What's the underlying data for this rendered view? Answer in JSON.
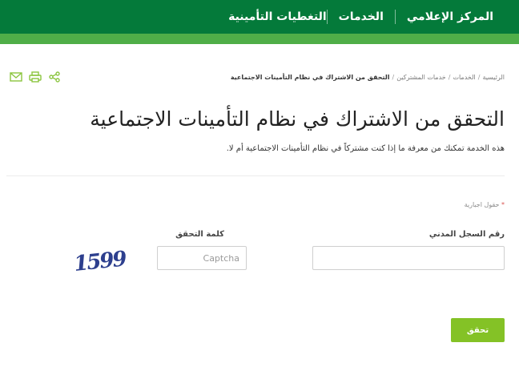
{
  "nav": {
    "items": [
      {
        "label": "التغطيات التأمينية"
      },
      {
        "label": "الخدمات"
      },
      {
        "label": "المركز الإعلامي"
      }
    ]
  },
  "breadcrumb": {
    "items": [
      "الرئيسية",
      "الخدمات",
      "خدمات المشتركين"
    ],
    "separator": "/",
    "current": "التحقق من الاشتراك في نظام التأمينات الاجتماعية"
  },
  "tools": {
    "icons": [
      "share-icon",
      "print-icon",
      "email-icon"
    ]
  },
  "page": {
    "title": "التحقق من الاشتراك في نظام التأمينات الاجتماعية",
    "description": "هذه الخدمة تمكنك من معرفة ما إذا كنت مشتركاً في نظام التأمينات الاجتماعية أم لا."
  },
  "form": {
    "required_star": "*",
    "required_note": "حقول اجبارية",
    "id_label": "رقم السجل المدني",
    "id_value": "",
    "captcha_label": "كلمة التحقق",
    "captcha_placeholder": "Captcha",
    "captcha_image_text": "1599",
    "submit_label": "تحقق"
  },
  "colors": {
    "header_dark": "#047a3a",
    "header_light": "#4fae48",
    "submit": "#84c226",
    "icons": "#8bc53f",
    "captcha_text": "#2d3f8e"
  }
}
